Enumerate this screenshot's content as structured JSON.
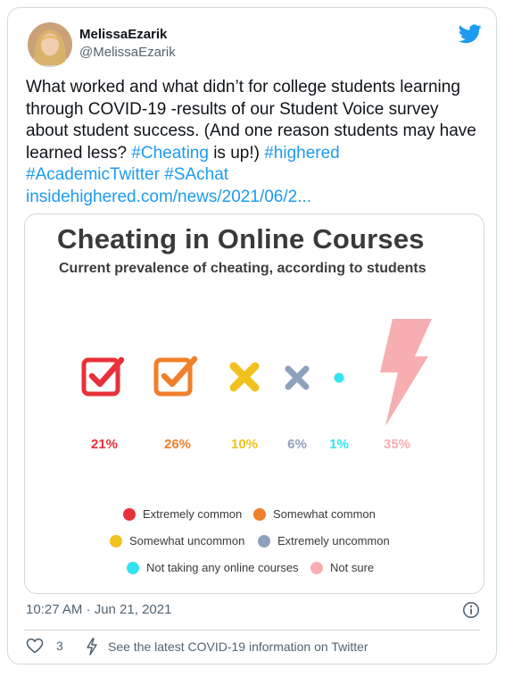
{
  "author": {
    "name": "MelissaEzarik",
    "handle": "@MelissaEzarik"
  },
  "tweet": {
    "text": "What worked and what didn’t for college students learning through COVID-19 -results of our Student Voice survey about student success. (And one reason students may have learned less? ",
    "hashtag_cheating": "#Cheating",
    "text_after": " is up!) ",
    "hashtag_highered": "#highered",
    "hashtag_academic": "#AcademicTwitter",
    "hashtag_sachat": "#SAchat",
    "link": "insidehighered.com/news/2021/06/2..."
  },
  "infographic": {
    "title": "Cheating in Online Courses",
    "subtitle": "Current prevalence of cheating, according to students",
    "items": [
      {
        "label": "Extremely common",
        "value": "21%",
        "color": "#e8303a",
        "icon": "checkbox-check-icon"
      },
      {
        "label": "Somewhat common",
        "value": "26%",
        "color": "#f07f2a",
        "icon": "checkbox-check-icon"
      },
      {
        "label": "Somewhat uncommon",
        "value": "10%",
        "color": "#f2c11f",
        "icon": "x-mark-icon"
      },
      {
        "label": "Extremely uncommon",
        "value": "6%",
        "color": "#8fa0bd",
        "icon": "x-mark-icon"
      },
      {
        "label": "Not taking any online courses",
        "value": "1%",
        "color": "#33e3ef",
        "icon": "dot-icon"
      },
      {
        "label": "Not sure",
        "value": "35%",
        "color": "#f7aeb0",
        "icon": "lightning-icon"
      }
    ]
  },
  "meta": {
    "timestamp": "10:27 AM · Jun 21, 2021",
    "likes": "3",
    "covid_link": "See the latest COVID-19 information on Twitter"
  },
  "colors": {
    "link": "#1d9bf0",
    "muted": "#536471",
    "border": "#cfd9de"
  }
}
